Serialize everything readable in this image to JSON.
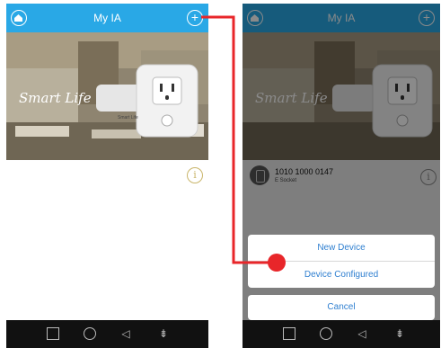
{
  "left_screen": {
    "appbar": {
      "title": "My IA",
      "plus_symbol": "+",
      "home_icon": "home-icon",
      "plus_icon": "plus-circle-icon"
    },
    "banner": {
      "caption": "Smart Life",
      "brand": "Smart Life"
    },
    "info_symbol": "i",
    "navbar": {
      "square": "square-icon",
      "circle": "circle-icon",
      "back": "◁",
      "menu": "⇟"
    }
  },
  "right_screen": {
    "appbar": {
      "title": "My IA",
      "plus_symbol": "+"
    },
    "banner": {
      "caption": "Smart Life"
    },
    "device": {
      "name": "1010 1000 0147",
      "type": "E Socket",
      "icon": "socket-icon"
    },
    "info_symbol": "i",
    "action_sheet": {
      "new_device": "New Device",
      "device_configured": "Device Configured",
      "cancel": "Cancel"
    },
    "navbar": {
      "square": "square-icon",
      "circle": "circle-icon",
      "back": "◁",
      "menu": "⇟"
    }
  },
  "annotation": {
    "connector_color": "#e8262a"
  }
}
